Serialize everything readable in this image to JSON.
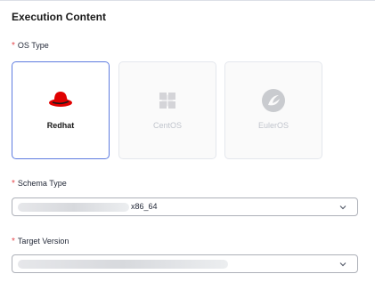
{
  "section": {
    "title": "Execution Content"
  },
  "os_type": {
    "label": "OS Type",
    "required_mark": "*",
    "options": [
      {
        "name": "Redhat",
        "icon": "redhat-icon",
        "selected": true
      },
      {
        "name": "CentOS",
        "icon": "centos-icon",
        "selected": false
      },
      {
        "name": "EulerOS",
        "icon": "euleros-icon",
        "selected": false
      }
    ]
  },
  "schema_type": {
    "label": "Schema Type",
    "required_mark": "*",
    "value": "x86_64"
  },
  "target_version": {
    "label": "Target Version",
    "required_mark": "*",
    "value": ""
  },
  "colors": {
    "accent": "#5e7ce0",
    "required": "#e5484d",
    "redhat": "#e00000"
  }
}
